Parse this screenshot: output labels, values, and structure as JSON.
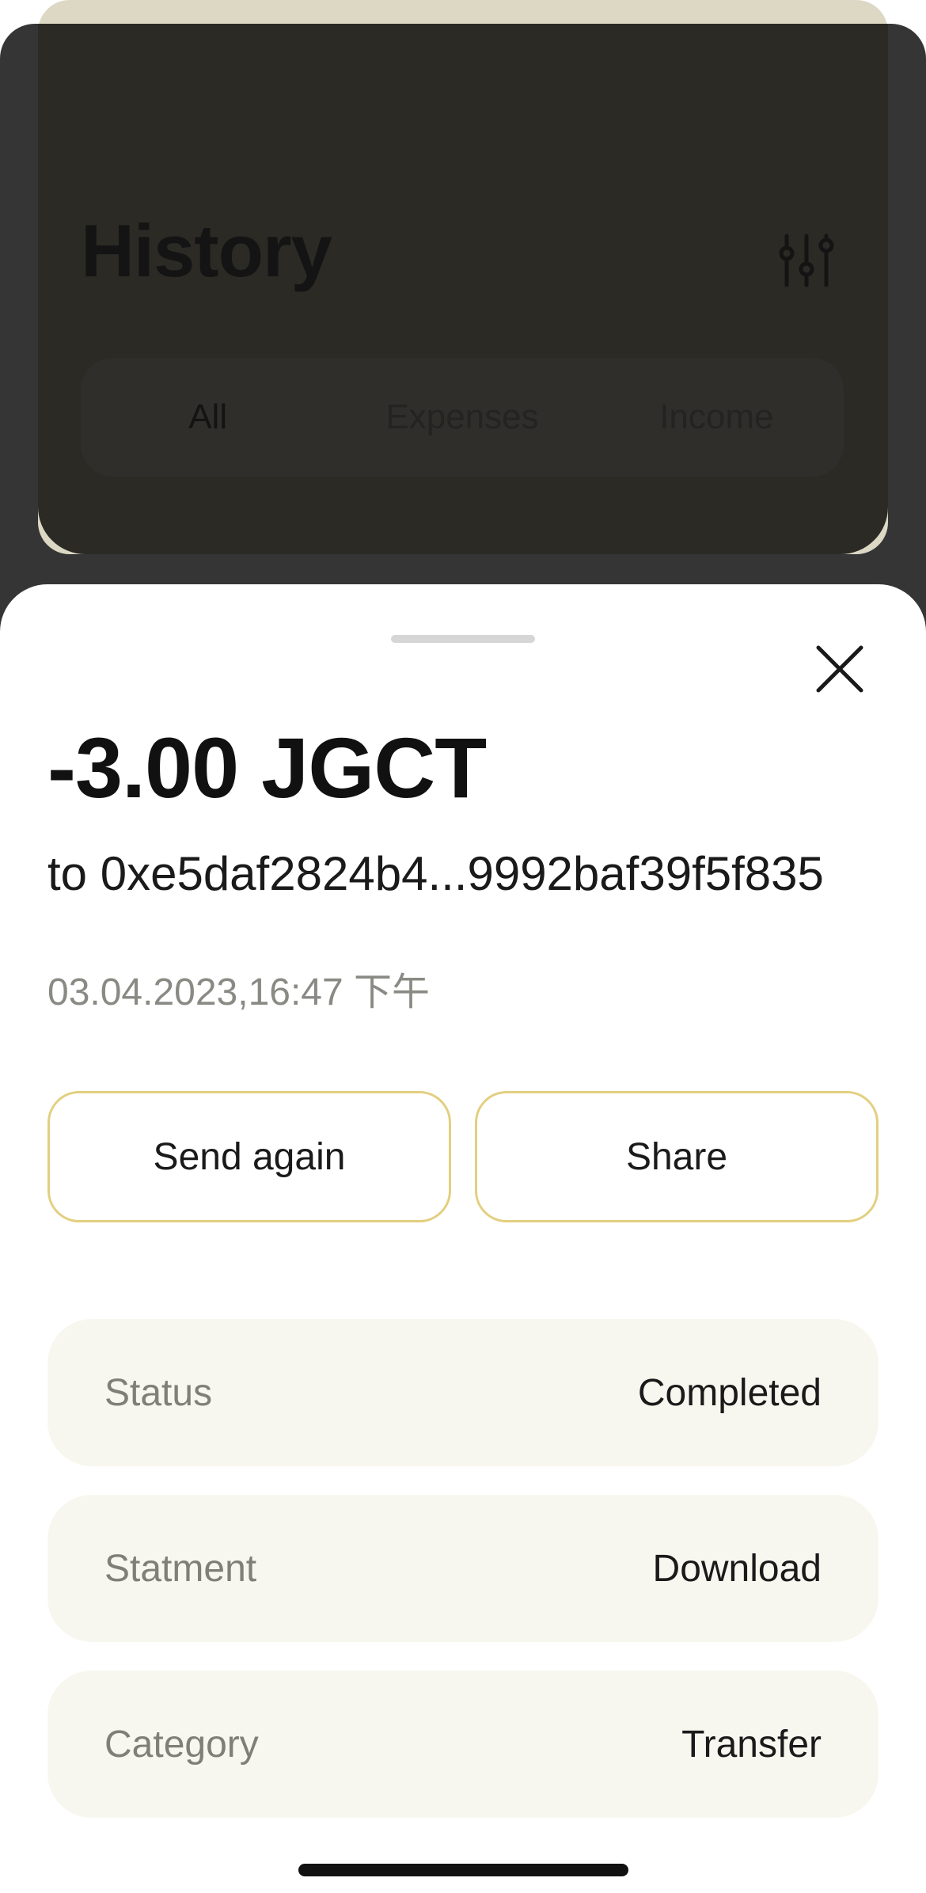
{
  "background": {
    "title": "History",
    "filter_icon": "sliders-icon",
    "segments": [
      {
        "label": "All"
      },
      {
        "label": "Expenses"
      },
      {
        "label": "Income"
      }
    ]
  },
  "sheet": {
    "amount": "-3.00 JGCT",
    "recipient": "to 0xe5daf2824b4...9992baf39f5f835",
    "datetime": "03.04.2023,16:47 下午",
    "close_icon": "close-icon",
    "actions": {
      "send_again": "Send again",
      "share": "Share"
    },
    "details": [
      {
        "label": "Status",
        "value": "Completed"
      },
      {
        "label": "Statment",
        "value": "Download"
      },
      {
        "label": "Category",
        "value": "Transfer"
      }
    ]
  },
  "colors": {
    "accent_border": "#e3cf7f",
    "detail_row_bg": "#f8f7ef",
    "dim_overlay": "#353535"
  }
}
